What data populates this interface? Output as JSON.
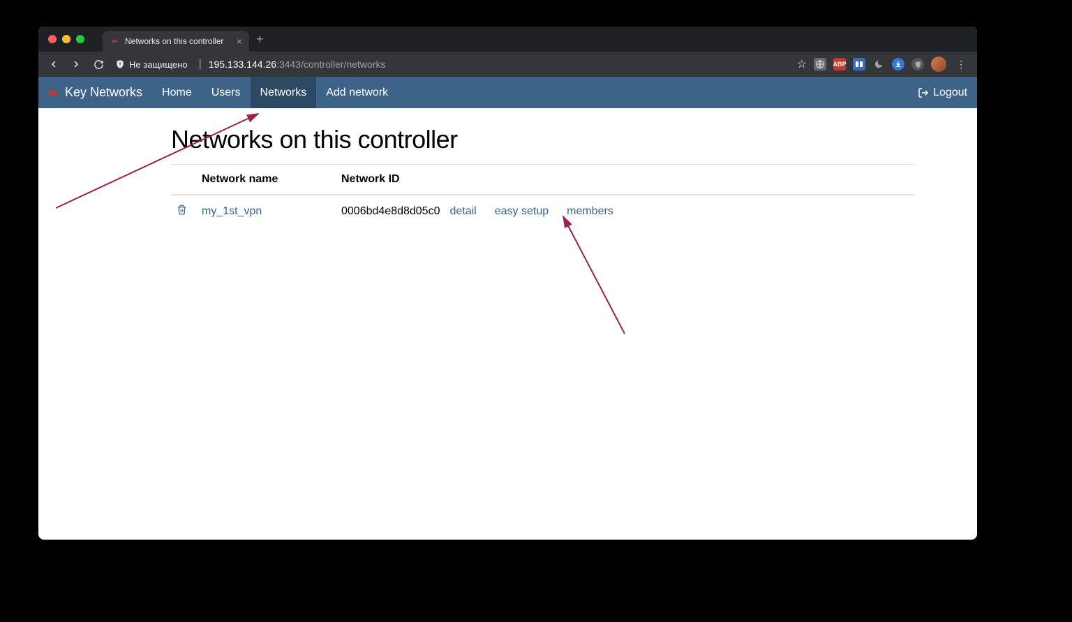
{
  "browser": {
    "tab_title": "Networks on this controller",
    "security_label": "Не защищено",
    "url_host": "195.133.144.26",
    "url_path": ":3443/controller/networks"
  },
  "nav": {
    "brand": "Key Networks",
    "items": [
      "Home",
      "Users",
      "Networks",
      "Add network"
    ],
    "active_index": 2,
    "logout": "Logout"
  },
  "page": {
    "title": "Networks on this controller",
    "columns": [
      "Network name",
      "Network ID"
    ],
    "rows": [
      {
        "name": "my_1st_vpn",
        "id": "0006bd4e8d8d05c0",
        "actions": [
          "detail",
          "easy setup",
          "members"
        ]
      }
    ]
  },
  "extensions": {
    "abp": "ABP",
    "translate": "",
    "download": ""
  }
}
